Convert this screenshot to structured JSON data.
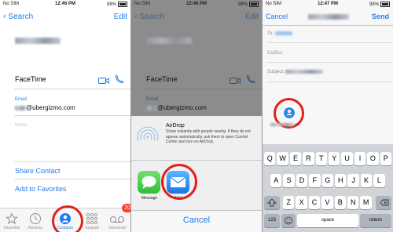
{
  "status": {
    "carrier": "No SIM",
    "p1_time": "12:46 PM",
    "p2_time": "12:46 PM",
    "p3_time": "12:47 PM",
    "battery": "98%"
  },
  "contact": {
    "back_label": "Search",
    "edit_label": "Edit",
    "facetime_label": "FaceTime",
    "email_label": "Email",
    "email_value": "@ubergizmo.com",
    "notes_label": "Notes",
    "share_contact": "Share Contact",
    "add_favorites": "Add to Favorites"
  },
  "tabbar": {
    "favorites": "Favorites",
    "recents": "Recents",
    "contacts": "Contacts",
    "keypad": "Keypad",
    "voicemail": "Voicemail",
    "voicemail_badge": "20"
  },
  "share": {
    "back_label": "Search",
    "edit_label": "Edit",
    "facetime_label": "FaceTime",
    "email_label": "Email",
    "email_value": "@ubergizmo.com",
    "airdrop_title": "AirDrop",
    "airdrop_desc": "Share instantly with people nearby. If they do not appear automatically, ask them to open Control Center and turn on AirDrop.",
    "message_label": "Message",
    "mail_label": "Mail",
    "cancel_label": "Cancel"
  },
  "compose": {
    "cancel_label": "Cancel",
    "send_label": "Send",
    "to_label": "To:",
    "ccbcc_label": "Cc/Bcc:",
    "subject_label": "Subject:",
    "attachment_ext": ".vcf"
  },
  "keyboard": {
    "row1": [
      "Q",
      "W",
      "E",
      "R",
      "T",
      "Y",
      "U",
      "I",
      "O",
      "P"
    ],
    "row2": [
      "A",
      "S",
      "D",
      "F",
      "G",
      "H",
      "J",
      "K",
      "L"
    ],
    "row3": [
      "Z",
      "X",
      "C",
      "V",
      "B",
      "N",
      "M"
    ],
    "numbers_key": "123",
    "space_key": "space",
    "return_key": "return"
  },
  "colors": {
    "accent": "#1e7cf2",
    "highlight_ring": "#e0211b",
    "badge": "#ff3b30"
  }
}
